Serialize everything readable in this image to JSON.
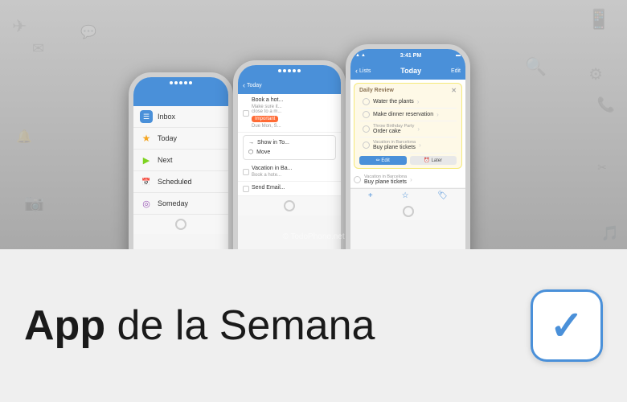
{
  "background": {
    "top_color": "#c0c0c0",
    "bottom_color": "#efefef"
  },
  "phones": {
    "left": {
      "status": ".....",
      "menu_items": [
        {
          "id": "inbox",
          "icon": "inbox",
          "label": "Inbox",
          "icon_color": "#4a90d9"
        },
        {
          "id": "today",
          "icon": "★",
          "label": "Today",
          "icon_color": "#f5a623"
        },
        {
          "id": "next",
          "icon": "→",
          "label": "Next",
          "icon_color": "#7ed321"
        },
        {
          "id": "scheduled",
          "icon": "📅",
          "label": "Scheduled",
          "icon_color": "#e74c3c"
        },
        {
          "id": "someday",
          "icon": "☁",
          "label": "Someday",
          "icon_color": "#9b59b6"
        }
      ]
    },
    "center": {
      "header_back": "Today",
      "tasks": [
        {
          "title": "Book a hot...",
          "sub": "Make sure it...",
          "sub2": "close to a m...",
          "badge": "Important",
          "due": "Due Mon, S..."
        },
        {
          "title": "Vacation in Ba...",
          "sub": "Book a hote..."
        },
        {
          "title": "Send Email..."
        }
      ],
      "context_menu": [
        {
          "label": "Show in To...",
          "icon": "→"
        },
        {
          "label": "Move",
          "icon": "⬡"
        }
      ]
    },
    "right": {
      "time": "3:41 PM",
      "header_back": "Lists",
      "header_title": "Today",
      "header_action": "Edit",
      "daily_review": {
        "title": "Daily Review",
        "tasks": [
          {
            "text": "Water the plants",
            "group": ""
          },
          {
            "text": "Make dinner reservation",
            "group": ""
          },
          {
            "text": "Order cake",
            "group": "Throw Birthday Party"
          },
          {
            "text": "Buy plane tickets",
            "group": "Vacation in Barcelona"
          }
        ]
      },
      "bottom_actions": [
        "+",
        "☆",
        "🏷"
      ]
    }
  },
  "bottom_bar": {
    "title_bold": "App",
    "title_normal": " de la Semana",
    "app_icon_symbol": "✓",
    "app_border_color": "#4a90d9"
  },
  "watermark": "© TodoPhone.net"
}
